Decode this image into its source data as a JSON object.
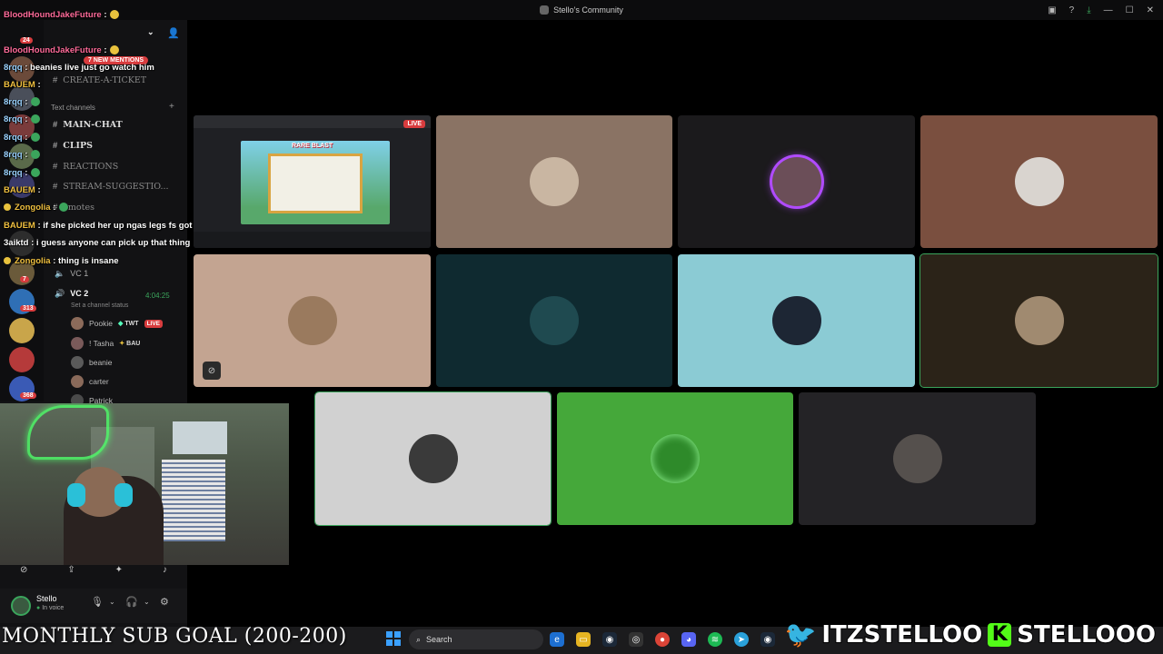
{
  "window": {
    "title": "Stello's Community"
  },
  "server": {
    "name": "Stello's Community",
    "new_mentions": "7 NEW MENTIONS",
    "categories": [
      "Text channels"
    ],
    "channels": [
      {
        "name": "CREATE-A-TICKET",
        "dim": true
      },
      {
        "name": "MAIN-CHAT",
        "dim": false
      },
      {
        "name": "CLIPS",
        "dim": false
      },
      {
        "name": "REACTIONS",
        "dim": true
      },
      {
        "name": "STREAM-SUGGESTIO...",
        "dim": true
      },
      {
        "name": "emotes",
        "dim": true
      }
    ],
    "voice_channels": [
      {
        "name": "VC 1"
      },
      {
        "name": "VC 2",
        "timer": "4:04:25",
        "status": "Set a channel status"
      }
    ],
    "voice_members": [
      {
        "name": "Pookie",
        "tag": "TWT",
        "live": "LIVE"
      },
      {
        "name": "! Tasha",
        "tag": "BAU"
      },
      {
        "name": "beanie"
      },
      {
        "name": "carter"
      },
      {
        "name": "Patrick"
      }
    ],
    "guild_badges": [
      "24",
      "7",
      "313",
      "368"
    ]
  },
  "chat": [
    {
      "user": "BloodHoundJakeFuture",
      "text": ":",
      "color": "#ff6b9a"
    },
    {
      "user": "BloodHoundJakeFuture",
      "text": ":",
      "color": "#ff6b9a"
    },
    {
      "user": "8rqq",
      "text": ": beanies live just go watch him",
      "color": "#9bd3ff"
    },
    {
      "user": "BAUEM",
      "text": ":",
      "color": "#f0c040"
    },
    {
      "user": "8rqq",
      "text": ":",
      "color": "#9bd3ff"
    },
    {
      "user": "8rqq",
      "text": ":",
      "color": "#9bd3ff"
    },
    {
      "user": "8rqq",
      "text": ":",
      "color": "#9bd3ff"
    },
    {
      "user": "8rqq",
      "text": ":",
      "color": "#9bd3ff"
    },
    {
      "user": "8rqq",
      "text": ":",
      "color": "#9bd3ff"
    },
    {
      "user": "BAUEM",
      "text": ":",
      "color": "#f0c040"
    },
    {
      "user": "Zongolia",
      "text": ":",
      "color": "#f0c040"
    },
    {
      "user": "BAUEM",
      "text": ": if she picked her up ngas legs fs got arthritis",
      "color": "#f0c040"
    },
    {
      "user": "3aiktd",
      "text": ": i guess anyone can pick up that thing",
      "color": "#ffffff"
    },
    {
      "user": "Zongolia",
      "text": ": thing is insane",
      "color": "#f0c040"
    }
  ],
  "user_panel": {
    "name": "Stello",
    "status": "In voice"
  },
  "stream": {
    "live_label": "LIVE",
    "game_label": "RARE BLAST"
  },
  "overlay": {
    "sub_goal": "MONTHLY SUB GOAL (200-200)",
    "twitter_handle": "ITZSTELLOO",
    "kick_letter": "K",
    "kick_handle": "STELLOOO"
  },
  "taskbar": {
    "search_label": "Search"
  },
  "colors": {
    "accent_green": "#3ba55c",
    "live_red": "#d83c3e",
    "kick_green": "#53fc18",
    "twitter_blue": "#1da1f2"
  }
}
